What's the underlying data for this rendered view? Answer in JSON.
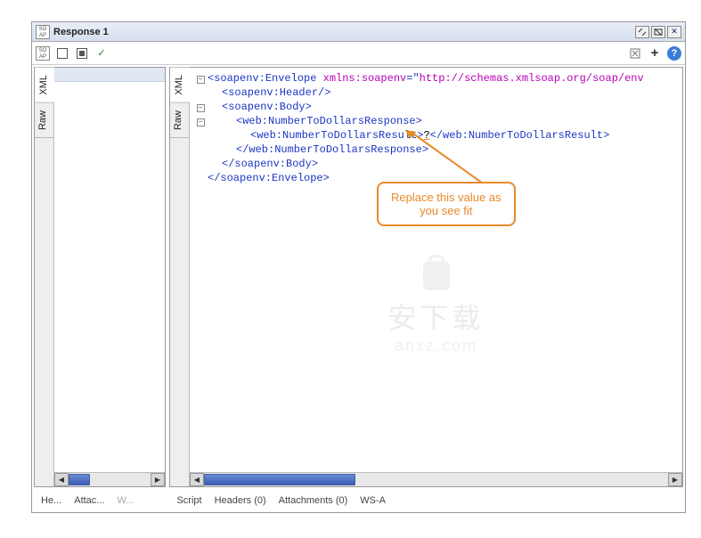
{
  "window": {
    "title": "Response 1"
  },
  "sideTabs": {
    "raw": "Raw",
    "xml": "XML"
  },
  "leftTabs": {
    "t1": "He...",
    "t2": "Attac...",
    "t3": "W..."
  },
  "rightTabs": {
    "t1": "Script",
    "t2": "Headers (0)",
    "t3": "Attachments (0)",
    "t4": "WS-A"
  },
  "xml": {
    "l1_open": "<",
    "l1_tag": "soapenv:Envelope",
    "l1_sp": " ",
    "l1_attrn": "xmlns:soapenv",
    "l1_eq": "=\"",
    "l1_attrv": "http://schemas.xmlsoap.org/soap/env",
    "l1_close": "",
    "l2": "<soapenv:Header/>",
    "l3": "<soapenv:Body>",
    "l4": "<web:NumberToDollarsResponse>",
    "l5a": "<web:NumberToDollarsResult>",
    "l5b": "?",
    "l5c": "</web:NumberToDollarsResult>",
    "l6": "</web:NumberToDollarsResponse>",
    "l7": "</soapenv:Body>",
    "l8": "</soapenv:Envelope>"
  },
  "callout": {
    "line1": "Replace this value as",
    "line2": "you see fit"
  },
  "watermark": {
    "cn": "安下载",
    "en": "anxz.com"
  }
}
